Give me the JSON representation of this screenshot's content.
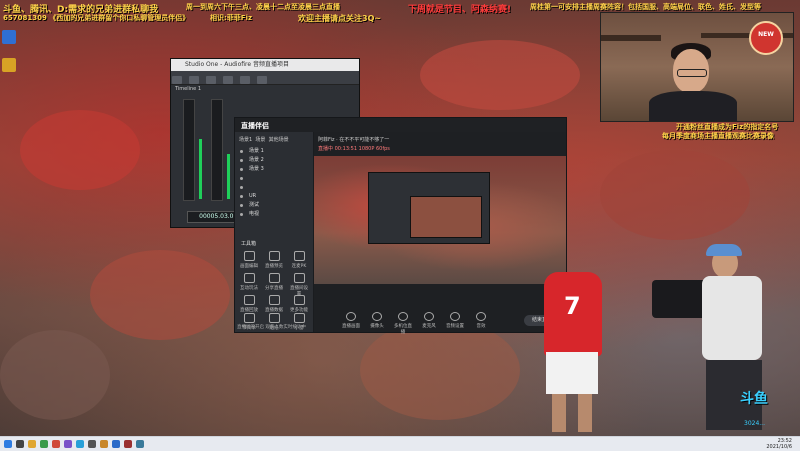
{
  "overlays": {
    "top_left_line1": "斗鱼、腾讯、D:需求的兄弟进群私聊我",
    "top_left_line2": "657081309  《西加的兄弟进群留个你口私聊管理员伴侣》",
    "top_left_qq": "相识:菲菲Fiz",
    "top_center": "周一到周六下午三点、凌晨十二点至凌晨三点直播",
    "top_center2": "欢迎主播请点关注3Q~",
    "top_right_red1": "下周就是节目、阿森纳赛!",
    "top_right_yellow": "周桂第一可安排主播周赛阵容！包括国服、高端局位、联色、姓氏、发型等",
    "right_mid1": "开通粉丝直播成为Fiz的指定名号",
    "right_mid2": "每月季度商场主播直播观赛比赛录像"
  },
  "mixer": {
    "title": "Studio One - Audiofire 音频直播项目",
    "timecode": "00005.03.01.23",
    "track_label": "Timeline 1"
  },
  "app": {
    "name": "直播伴侣",
    "tabs": [
      "场景1",
      "场景",
      "其他场景"
    ],
    "scenes": [
      "场景 1",
      "场景 2",
      "场景 3",
      "",
      "",
      "UR",
      "测试",
      "电视"
    ],
    "tools_title": "工具箱",
    "tools": [
      "画面编辑",
      "直播预览",
      "连麦PK",
      "互动玩法",
      "分享直播",
      "直播间设置",
      "直播回放",
      "直播数据",
      "更多功能",
      "节目单",
      "贴纸",
      "小窗"
    ],
    "preview_title": "阿菲Fiz · 在不不平可能不够了一",
    "preview_info": "直播中  00:13:51  1080P 60fps",
    "controls": [
      "直播画面",
      "摄像头",
      "多机位直播",
      "麦克风",
      "音频设置",
      "音效"
    ],
    "go_live": "结束直播",
    "status": "直播间已开启  观看人数实时统计中"
  },
  "webcam": {
    "badge": "NEW"
  },
  "player": {
    "number": "7"
  },
  "watermark": {
    "brand": "斗鱼",
    "room": "3024..."
  },
  "taskbar": {
    "time": "23:52",
    "date": "2021/10/6"
  }
}
